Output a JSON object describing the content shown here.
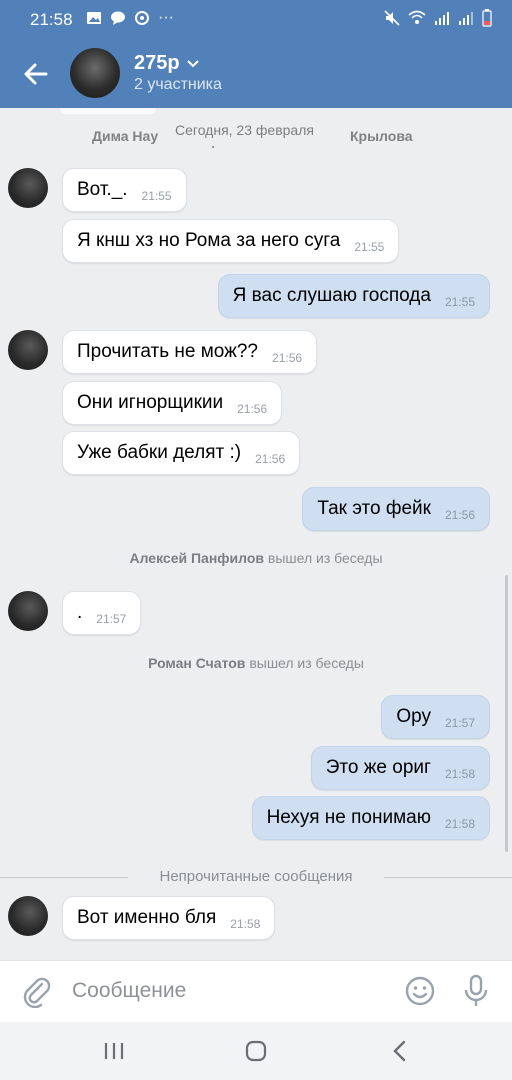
{
  "status_bar": {
    "time": "21:58",
    "dots": "···"
  },
  "header": {
    "title": "275р",
    "subtitle": "2 участника"
  },
  "datebar": {
    "left_name": "Дима Нау",
    "date": "Сегодня, 23 февраля",
    "right_name": "Крылова"
  },
  "messages": [
    {
      "text": "Вот._.",
      "time": "21:55"
    },
    {
      "text": "Я кнш хз но Рома за него суга",
      "time": "21:55"
    },
    {
      "text": "Я вас слушаю господа",
      "time": "21:55"
    },
    {
      "text": "Прочитать не мож??",
      "time": "21:56"
    },
    {
      "text": "Они игнорщикии",
      "time": "21:56"
    },
    {
      "text": "Уже бабки делят :)",
      "time": "21:56"
    },
    {
      "text": "Так это фейк",
      "time": "21:56"
    },
    {
      "text": ".",
      "time": "21:57"
    },
    {
      "text": "Ору",
      "time": "21:57"
    },
    {
      "text": "Это же ориг",
      "time": "21:58"
    },
    {
      "text": "Нехуя не понимаю",
      "time": "21:58"
    },
    {
      "text": "Вот именно бля",
      "time": "21:58"
    }
  ],
  "system": [
    {
      "name": "Алексей Панфилов",
      "action": "вышел из беседы"
    },
    {
      "name": "Роман Счатов",
      "action": "вышел из беседы"
    }
  ],
  "unread_label": "Непрочитанные сообщения",
  "input": {
    "placeholder": "Сообщение"
  },
  "colors": {
    "header": "#5181b8",
    "incoming": "#ffffff",
    "outgoing": "#cfdff1",
    "background": "#edeef0"
  }
}
